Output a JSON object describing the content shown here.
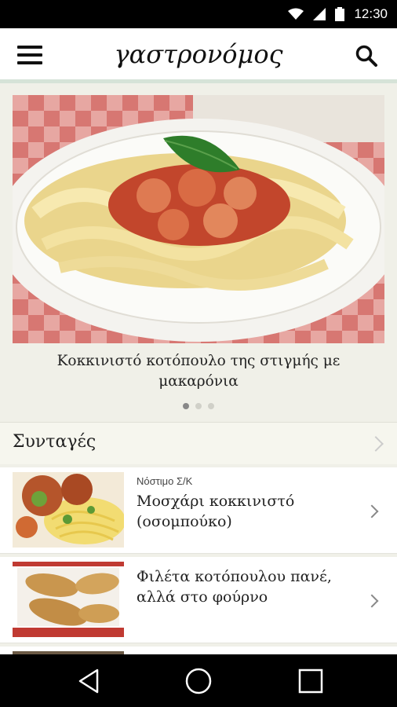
{
  "status_bar": {
    "time": "12:30",
    "icons": [
      "wifi-icon",
      "signal-icon",
      "battery-icon"
    ]
  },
  "app_bar": {
    "logo": "γαστρονόμος",
    "menu_icon": "hamburger-menu-icon",
    "search_icon": "search-icon"
  },
  "hero": {
    "caption": "Κοκκινιστό κοτόπουλο της στιγμής με μακαρόνια",
    "dots": 3,
    "active_dot": 1
  },
  "section": {
    "title": "Συνταγές"
  },
  "recipes": [
    {
      "tag": "Νόστιμο Σ/Κ",
      "title": "Μοσχάρι κοκκινιστό (οσομπούκο)"
    },
    {
      "tag": "",
      "title": "Φιλέτα κοτόπουλου πανέ, αλλά στο φούρνο"
    }
  ],
  "nav": {
    "back_icon": "back-triangle-icon",
    "home_icon": "home-circle-icon",
    "recents_icon": "recents-square-icon"
  },
  "colors": {
    "background": "#f0f0e8",
    "app_bar_accent": "#d6e3d8",
    "status_bar": "#000000"
  }
}
